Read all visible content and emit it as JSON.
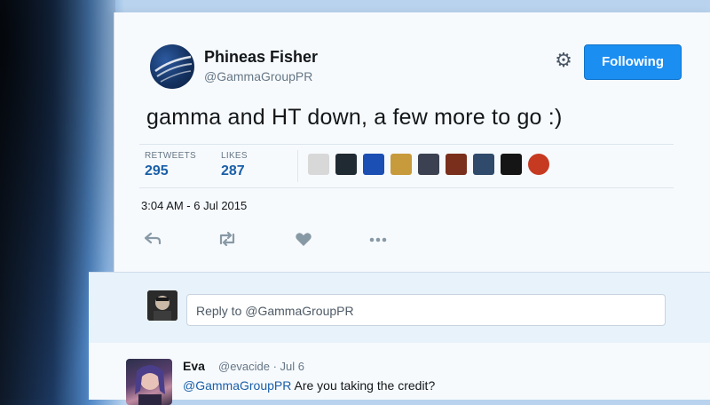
{
  "tweet": {
    "author_name": "Phineas Fisher",
    "author_handle": "@GammaGroupPR",
    "follow_label": "Following",
    "text": "gamma and HT down, a few more to go :)",
    "retweets_label": "RETWEETS",
    "retweets_count": "295",
    "likes_label": "LIKES",
    "likes_count": "287",
    "timestamp": "3:04 AM - 6 Jul 2015"
  },
  "icons": {
    "settings": "gear-icon",
    "reply": "reply-icon",
    "retweet": "retweet-icon",
    "like": "heart-icon",
    "more": "more-icon"
  },
  "likers": [
    {
      "name": "liker-avatar-1",
      "color": "#d8d8d8"
    },
    {
      "name": "liker-avatar-2",
      "color": "#1f2a33"
    },
    {
      "name": "liker-avatar-3",
      "color": "#1c4fb3"
    },
    {
      "name": "liker-avatar-4",
      "color": "#c79a3b"
    },
    {
      "name": "liker-avatar-5",
      "color": "#3b4150"
    },
    {
      "name": "liker-avatar-6",
      "color": "#7a2f1c"
    },
    {
      "name": "liker-avatar-7",
      "color": "#2f4a6a"
    },
    {
      "name": "liker-avatar-8",
      "color": "#151515"
    },
    {
      "name": "liker-avatar-9",
      "color": "#c63a22"
    }
  ],
  "reply_box": {
    "placeholder": "Reply to @GammaGroupPR"
  },
  "reply": {
    "name": "Eva",
    "meta": "@evacide · Jul 6",
    "mention": "@GammaGroupPR",
    "text": " Are you taking the credit?"
  },
  "colors": {
    "accent": "#1b8ef2",
    "link": "#1a5fa8",
    "muted": "#657786"
  }
}
